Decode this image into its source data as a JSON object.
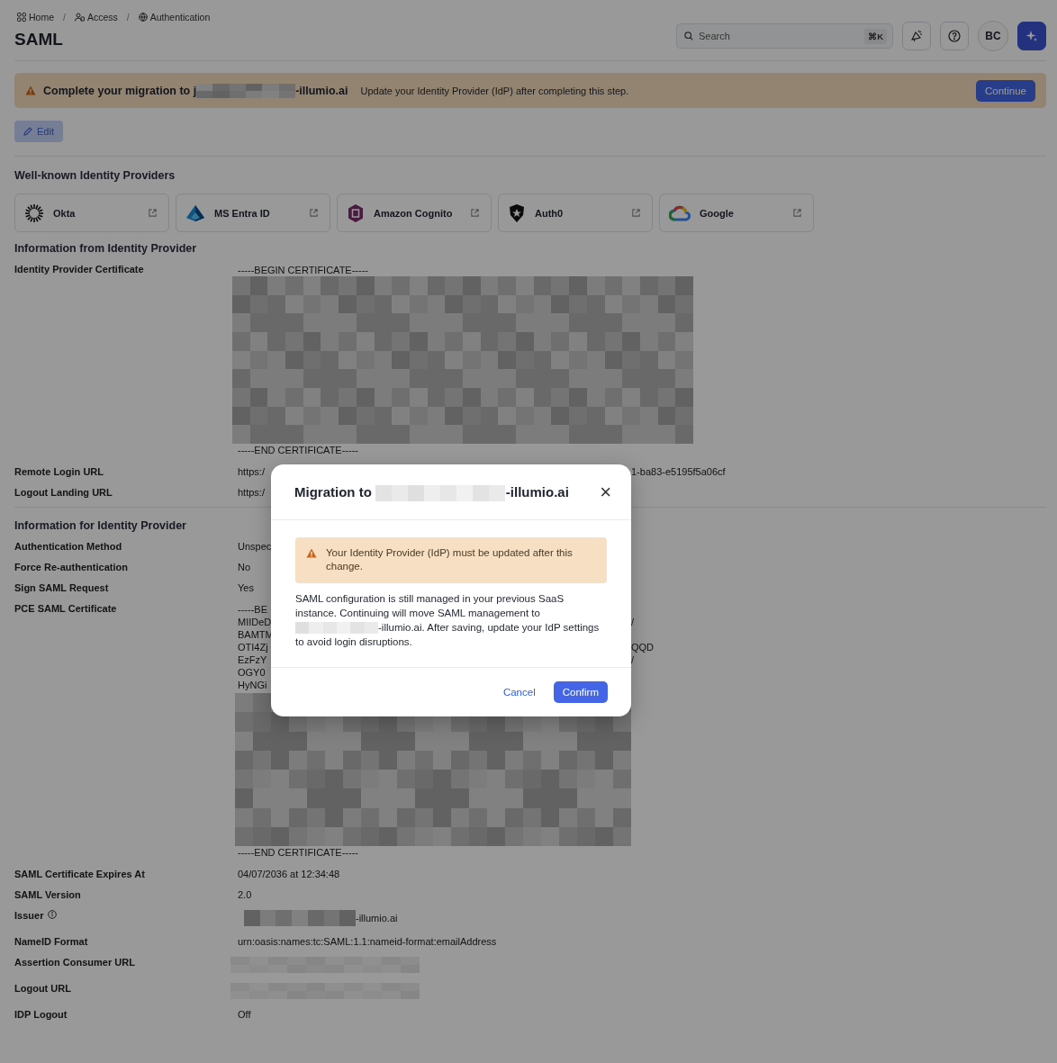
{
  "breadcrumb": [
    {
      "label": "Home"
    },
    {
      "separator": "/",
      "label": "Access"
    },
    {
      "separator": "/",
      "label": "Authentication"
    }
  ],
  "page_title": "SAML",
  "search": {
    "placeholder": "Search",
    "shortcut": "⌘K"
  },
  "avatar": "BC",
  "banner": {
    "title_start": "Complete your migration to j",
    "title_end": "-illumio.ai",
    "message": "Update your Identity Provider (IdP) after completing this step.",
    "button": "Continue"
  },
  "edit_button": {
    "label": "Edit",
    "disabled": true
  },
  "providers_heading": "Well-known Identity Providers",
  "providers": [
    {
      "name": "Okta"
    },
    {
      "name": "MS Entra ID"
    },
    {
      "name": "Amazon Cognito"
    },
    {
      "name": "Auth0"
    },
    {
      "name": "Google"
    }
  ],
  "sections": [
    {
      "heading": "Information from Identity Provider",
      "rows": [
        {
          "label": "Identity Provider Certificate",
          "kind": "certificate",
          "begin": "-----BEGIN CERTIFICATE-----",
          "lines": [],
          "end": "-----END CERTIFICATE-----"
        },
        {
          "label": "Remote Login URL",
          "kind": "split",
          "start": "https:/",
          "end": "1-ba83-e5195f5a06cf"
        },
        {
          "label": "Logout Landing URL",
          "kind": "split",
          "start": "https:/"
        }
      ]
    },
    {
      "heading": "Information for Identity Provider",
      "rows": [
        {
          "label": "Authentication Method",
          "kind": "text",
          "value": "Unspec"
        },
        {
          "label": "Force Re-authentication",
          "kind": "text",
          "value": "No"
        },
        {
          "label": "Sign SAML Request",
          "kind": "text",
          "value": "Yes"
        },
        {
          "label": "PCE SAML Certificate",
          "kind": "certificate",
          "begin": "-----BE",
          "lines": [
            {
              "start": "MIIDeD",
              "end": "/"
            },
            {
              "start": "BAMTM"
            },
            {
              "start": "OTI4Zj",
              "end": "QQD"
            },
            {
              "start": "EzFzY",
              "end": "/"
            },
            {
              "start": "OGY0"
            },
            {
              "start": "HyNGi"
            }
          ],
          "end": "-----END CERTIFICATE-----"
        },
        {
          "label": "SAML Certificate Expires At",
          "kind": "text",
          "value": "04/07/2036 at 12:34:48"
        },
        {
          "label": "SAML Version",
          "kind": "text",
          "value": "2.0"
        },
        {
          "label": "Issuer",
          "kind": "redacted_suffix",
          "info": true,
          "value": "-illumio.ai"
        },
        {
          "label": "NameID Format",
          "kind": "text",
          "value": "urn:oasis:names:tc:SAML:1.1:nameid-format:emailAddress"
        },
        {
          "label": "Assertion Consumer URL",
          "kind": "redacted"
        },
        {
          "label": "Logout URL",
          "kind": "redacted"
        },
        {
          "label": "IDP Logout",
          "kind": "text",
          "value": "Off"
        }
      ]
    }
  ],
  "modal": {
    "title_start": "Migration to",
    "title_end": "-illumio.ai",
    "close": "×",
    "warning": "Your Identity Provider (IdP) must be updated after this change.",
    "body_start": "SAML configuration is still managed in your previous SaaS instance. Continuing will move SAML management to",
    "body_end": "-illumio.ai. After saving, update your IdP settings to avoid login disruptions.",
    "cancel": "Cancel",
    "confirm": "Confirm"
  }
}
